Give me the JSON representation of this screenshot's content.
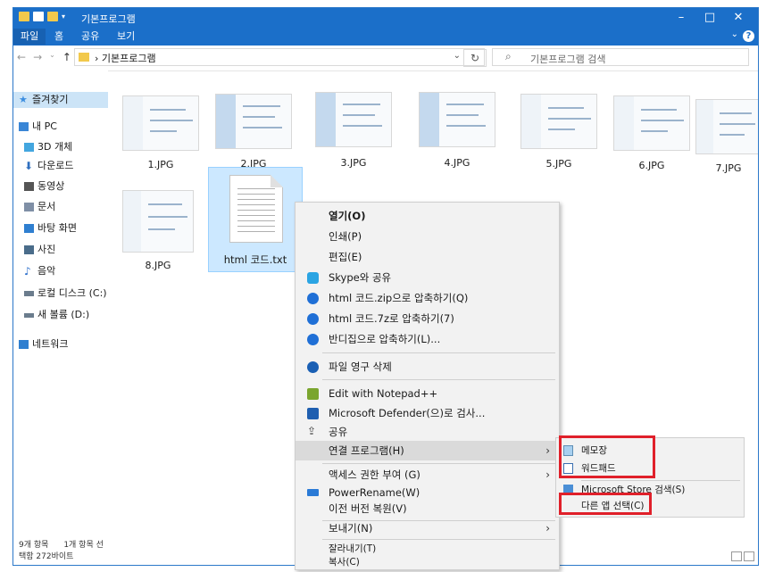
{
  "window": {
    "title": "기본프로그램",
    "min": "–",
    "max": "□",
    "close": "✕"
  },
  "ribbon": {
    "tabs": [
      "파일",
      "홈",
      "공유",
      "보기"
    ]
  },
  "address": {
    "path": "기본프로그램",
    "refresh": "↻",
    "search_placeholder": "기본프로그램 검색"
  },
  "sidebar": {
    "items": [
      {
        "label": "즐겨찾기",
        "icon": "star-icon",
        "color": "#3c8ee0"
      },
      {
        "label": "내 PC",
        "icon": "pc-icon",
        "color": "#3a86d6"
      },
      {
        "label": "3D 개체",
        "icon": "cube-icon",
        "color": "#43a6df"
      },
      {
        "label": "다운로드",
        "icon": "download-icon",
        "color": "#2f6fbf"
      },
      {
        "label": "동영상",
        "icon": "video-icon",
        "color": "#555555"
      },
      {
        "label": "문서",
        "icon": "document-icon",
        "color": "#7f8fa6"
      },
      {
        "label": "바탕 화면",
        "icon": "desktop-icon",
        "color": "#2f7fd0"
      },
      {
        "label": "사진",
        "icon": "picture-icon",
        "color": "#4a6c8a"
      },
      {
        "label": "음악",
        "icon": "music-icon",
        "color": "#2c6fcc"
      },
      {
        "label": "로컬 디스크 (C:)",
        "icon": "disk-icon",
        "color": "#6b7c8d"
      },
      {
        "label": "새 볼륨 (D:)",
        "icon": "volume-icon",
        "color": "#6b7c8d"
      },
      {
        "label": "네트워크",
        "icon": "network-icon",
        "color": "#2f7fd0"
      }
    ]
  },
  "files": [
    {
      "name": "1.JPG",
      "style": "light"
    },
    {
      "name": "2.JPG",
      "style": "blue"
    },
    {
      "name": "3.JPG",
      "style": "blue"
    },
    {
      "name": "4.JPG",
      "style": "blue"
    },
    {
      "name": "5.JPG",
      "style": "light"
    },
    {
      "name": "6.JPG",
      "style": "light"
    },
    {
      "name": "7.JPG",
      "style": "light"
    },
    {
      "name": "8.JPG",
      "style": "light"
    }
  ],
  "selected_file": {
    "name": "html 코드.txt"
  },
  "status": {
    "count": "9개 항목",
    "selection": "1개 항목 선택함 272바이트"
  },
  "context_menu": {
    "items": [
      {
        "label": "열기(O)",
        "bold": true
      },
      {
        "label": "인쇄(P)"
      },
      {
        "label": "편집(E)"
      },
      {
        "label": "Skype와 공유",
        "icon": "skype-icon",
        "color": "#2aa4e3"
      },
      {
        "label": "html 코드.zip으로 압축하기(Q)",
        "icon": "bandizip-icon",
        "color": "#1f6fd6"
      },
      {
        "label": "html 코드.7z로 압축하기(7)",
        "icon": "bandizip-icon",
        "color": "#1f6fd6"
      },
      {
        "label": "반디집으로 압축하기(L)...",
        "icon": "bandizip-icon",
        "color": "#1f6fd6"
      },
      {
        "label": "파일 영구 삭제",
        "icon": "shred-icon",
        "color": "#1a5fb4"
      },
      {
        "label": "Edit with Notepad++",
        "icon": "notepadpp-icon",
        "color": "#7aa52e"
      },
      {
        "label": "Microsoft Defender(으)로 검사...",
        "icon": "defender-icon",
        "color": "#1f5fb0"
      },
      {
        "label": "공유",
        "icon": "share-icon",
        "color": "#444444"
      },
      {
        "label": "연결 프로그램(H)",
        "highlighted": true,
        "submenu": true
      },
      {
        "label": "액세스 권한 부여 (G)",
        "submenu": true
      },
      {
        "label": "PowerRename(W)",
        "icon": "powerrename-icon",
        "color": "#2a7ad6"
      },
      {
        "label": "이전 버전 복원(V)"
      },
      {
        "label": "보내기(N)",
        "submenu": true
      },
      {
        "label": "잘라내기(T)"
      },
      {
        "label": "복사(C)"
      }
    ]
  },
  "submenu": {
    "items": [
      {
        "label": "메모장",
        "icon": "notepad-icon"
      },
      {
        "label": "워드패드",
        "icon": "wordpad-icon"
      },
      {
        "label": "Microsoft Store 검색(S)",
        "icon": "store-icon"
      },
      {
        "label": "다른 앱 선택(C)"
      }
    ]
  },
  "colors": {
    "accent": "#1b6fc9",
    "highlight_box": "#e0202a",
    "selection": "#cce8ff"
  }
}
